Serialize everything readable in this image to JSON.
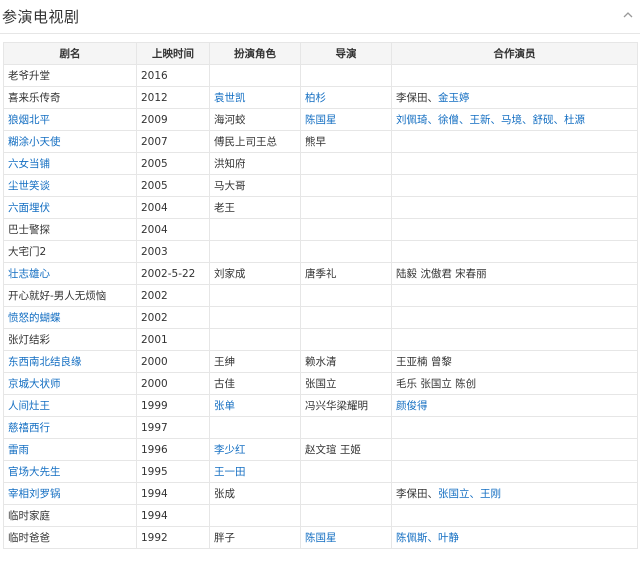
{
  "section": {
    "title": "参演电视剧"
  },
  "table": {
    "headers": [
      "剧名",
      "上映时间",
      "扮演角色",
      "导演",
      "合作演员"
    ],
    "rows": [
      {
        "title": {
          "text": "老爷升堂",
          "link": false
        },
        "year": "2016",
        "role": [],
        "director": [],
        "costars": []
      },
      {
        "title": {
          "text": "喜来乐传奇",
          "link": false
        },
        "year": "2012",
        "role": [
          {
            "text": "袁世凯",
            "link": true
          }
        ],
        "director": [
          {
            "text": "柏杉",
            "link": true
          }
        ],
        "costars": [
          {
            "text": "李保田",
            "link": false
          },
          {
            "text": "、",
            "link": false
          },
          {
            "text": "金玉婷",
            "link": true
          }
        ]
      },
      {
        "title": {
          "text": "狼烟北平",
          "link": true
        },
        "year": "2009",
        "role": [
          {
            "text": "海河蛟",
            "link": false
          }
        ],
        "director": [
          {
            "text": "陈国星",
            "link": true
          }
        ],
        "costars": [
          {
            "text": "刘佩琦、徐僧、王新、马境、舒砚、杜源",
            "link": true
          }
        ]
      },
      {
        "title": {
          "text": "糊涂小天使",
          "link": true
        },
        "year": "2007",
        "role": [
          {
            "text": "傅民上司王总",
            "link": false
          }
        ],
        "director": [
          {
            "text": "熊早",
            "link": false
          }
        ],
        "costars": []
      },
      {
        "title": {
          "text": "六女当铺",
          "link": true
        },
        "year": "2005",
        "role": [
          {
            "text": "洪知府",
            "link": false
          }
        ],
        "director": [],
        "costars": []
      },
      {
        "title": {
          "text": "尘世笑谈",
          "link": true
        },
        "year": "2005",
        "role": [
          {
            "text": "马大哥",
            "link": false
          }
        ],
        "director": [],
        "costars": []
      },
      {
        "title": {
          "text": "六面埋伏",
          "link": true
        },
        "year": "2004",
        "role": [
          {
            "text": "老王",
            "link": false
          }
        ],
        "director": [],
        "costars": []
      },
      {
        "title": {
          "text": "巴士警探",
          "link": false
        },
        "year": "2004",
        "role": [],
        "director": [],
        "costars": []
      },
      {
        "title": {
          "text": "大宅门2",
          "link": false
        },
        "year": "2003",
        "role": [],
        "director": [],
        "costars": []
      },
      {
        "title": {
          "text": "壮志雄心",
          "link": true
        },
        "year": "2002-5-22",
        "role": [
          {
            "text": "刘家成",
            "link": false
          }
        ],
        "director": [
          {
            "text": "唐季礼",
            "link": false
          }
        ],
        "costars": [
          {
            "text": "陆毅 沈傲君 宋春丽",
            "link": false
          }
        ]
      },
      {
        "title": {
          "text": "开心就好-男人无烦恼",
          "link": false
        },
        "year": "2002",
        "role": [],
        "director": [],
        "costars": []
      },
      {
        "title": {
          "text": "愤怒的蝴蝶",
          "link": true
        },
        "year": "2002",
        "role": [],
        "director": [],
        "costars": []
      },
      {
        "title": {
          "text": "张灯结彩",
          "link": false
        },
        "year": "2001",
        "role": [],
        "director": [],
        "costars": []
      },
      {
        "title": {
          "text": "东西南北结良缘",
          "link": true
        },
        "year": "2000",
        "role": [
          {
            "text": "王绅",
            "link": false
          }
        ],
        "director": [
          {
            "text": "赖水清",
            "link": false
          }
        ],
        "costars": [
          {
            "text": "王亚楠 曾黎",
            "link": false
          }
        ]
      },
      {
        "title": {
          "text": "京城大状师",
          "link": true
        },
        "year": "2000",
        "role": [
          {
            "text": "古佳",
            "link": false
          }
        ],
        "director": [
          {
            "text": "张国立",
            "link": false
          }
        ],
        "costars": [
          {
            "text": "毛乐 张国立 陈创",
            "link": false
          }
        ]
      },
      {
        "title": {
          "text": "人间灶王",
          "link": true
        },
        "year": "1999",
        "role": [
          {
            "text": "张单",
            "link": true
          }
        ],
        "director": [
          {
            "text": "冯兴华梁耀明",
            "link": false
          }
        ],
        "costars": [
          {
            "text": "颜俊得",
            "link": true
          }
        ]
      },
      {
        "title": {
          "text": "慈禧西行",
          "link": true
        },
        "year": "1997",
        "role": [],
        "director": [],
        "costars": []
      },
      {
        "title": {
          "text": "雷雨",
          "link": true
        },
        "year": "1996",
        "role": [
          {
            "text": "李少红",
            "link": true
          }
        ],
        "director": [
          {
            "text": "赵文瑄 王姬",
            "link": false
          }
        ],
        "costars": []
      },
      {
        "title": {
          "text": "官场大先生",
          "link": true
        },
        "year": "1995",
        "role": [
          {
            "text": "王一田",
            "link": true
          }
        ],
        "director": [],
        "costars": []
      },
      {
        "title": {
          "text": "宰相刘罗锅",
          "link": true
        },
        "year": "1994",
        "role": [
          {
            "text": "张成",
            "link": false
          }
        ],
        "director": [],
        "costars": [
          {
            "text": "李保田",
            "link": false
          },
          {
            "text": "、",
            "link": false
          },
          {
            "text": "张国立、王刚",
            "link": true
          }
        ]
      },
      {
        "title": {
          "text": "临时家庭",
          "link": false
        },
        "year": "1994",
        "role": [],
        "director": [],
        "costars": []
      },
      {
        "title": {
          "text": "临时爸爸",
          "link": false
        },
        "year": "1992",
        "role": [
          {
            "text": "胖子",
            "link": false
          }
        ],
        "director": [
          {
            "text": "陈国星",
            "link": true
          }
        ],
        "costars": [
          {
            "text": "陈佩斯、叶静",
            "link": true
          }
        ]
      }
    ]
  },
  "icons": {
    "collapse": "chevron-up-icon"
  },
  "colors": {
    "link": "#136ec2",
    "text": "#333333",
    "border": "#e6e6e6",
    "header_bg": "#f5f5f5"
  }
}
